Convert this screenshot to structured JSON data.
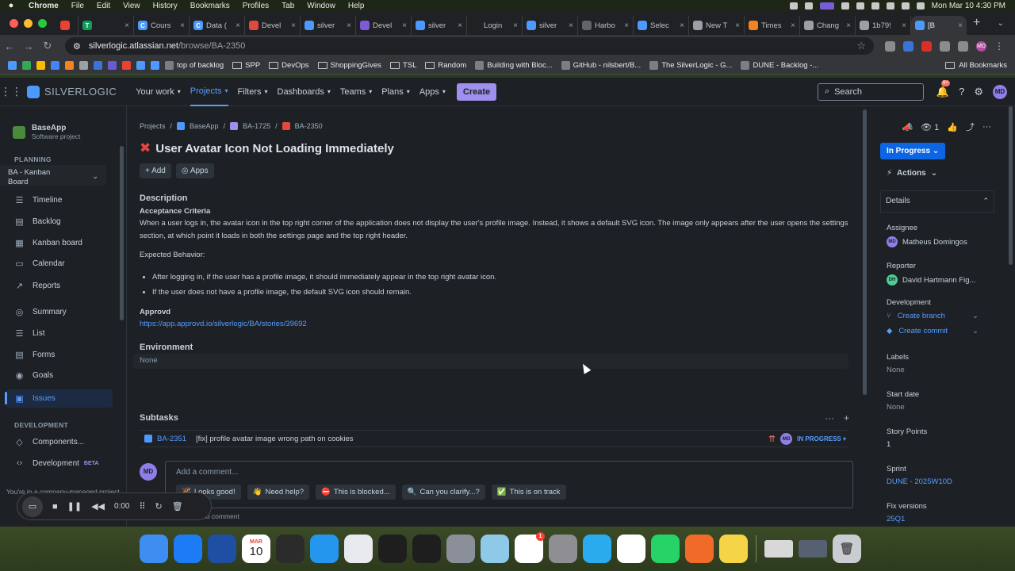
{
  "menubar": {
    "app": "Chrome",
    "items": [
      "File",
      "Edit",
      "View",
      "History",
      "Bookmarks",
      "Profiles",
      "Tab",
      "Window",
      "Help"
    ],
    "clock": "Mon Mar 10  4:30 PM"
  },
  "tabs": [
    {
      "label": "",
      "color": "#e94235"
    },
    {
      "label": "",
      "color": "#0f9d58",
      "glyph": "T"
    },
    {
      "label": "Cours",
      "color": "#4c9aff",
      "glyph": "C"
    },
    {
      "label": "Data (",
      "color": "#4c9aff",
      "glyph": "C"
    },
    {
      "label": "Devel",
      "color": "#e2483d"
    },
    {
      "label": "silver",
      "color": "#4c9aff"
    },
    {
      "label": "Devel",
      "color": "#7c5cd6"
    },
    {
      "label": "silver",
      "color": "#4c9aff"
    },
    {
      "label": "Login",
      "color": "#202124"
    },
    {
      "label": "silver",
      "color": "#4c9aff"
    },
    {
      "label": "Harbo",
      "color": "#60646b"
    },
    {
      "label": "Selec",
      "color": "#4c9aff"
    },
    {
      "label": "New T",
      "color": "#9aa0a6"
    },
    {
      "label": "Times",
      "color": "#f4821f"
    },
    {
      "label": "Chang",
      "color": "#9aa0a6"
    },
    {
      "label": "1b79!",
      "color": "#9aa0a6"
    },
    {
      "label": "[B",
      "color": "#4c9aff",
      "active": true
    }
  ],
  "address": {
    "host": "silverlogic.atlassian.net",
    "path": "/browse/BA-2350"
  },
  "bookmarks": [
    {
      "label": "top of backlog",
      "kind": "link"
    },
    {
      "label": "SPP",
      "kind": "folder"
    },
    {
      "label": "DevOps",
      "kind": "folder"
    },
    {
      "label": "ShoppingGives",
      "kind": "folder"
    },
    {
      "label": "TSL",
      "kind": "folder"
    },
    {
      "label": "Random",
      "kind": "folder"
    },
    {
      "label": "Building with Bloc...",
      "kind": "link"
    },
    {
      "label": "GitHub - nilsbert/B...",
      "kind": "link"
    },
    {
      "label": "The SilverLogic - G...",
      "kind": "link"
    },
    {
      "label": "DUNE - Backlog -...",
      "kind": "link"
    }
  ],
  "bookmarks_all": "All Bookmarks",
  "jira_nav": {
    "logo": "SILVERLOGIC",
    "items": [
      "Your work",
      "Projects",
      "Filters",
      "Dashboards",
      "Teams",
      "Plans",
      "Apps"
    ],
    "active": "Projects",
    "create": "Create",
    "search": "Search",
    "notif_count": "9+",
    "avatar": "MD"
  },
  "sidebar": {
    "project_name": "BaseApp",
    "project_type": "Software project",
    "planning_header": "PLANNING",
    "board_line1": "BA - Kanban",
    "board_line2": "Board",
    "items": [
      {
        "label": "Timeline",
        "icon": "timeline-icon"
      },
      {
        "label": "Backlog",
        "icon": "backlog-icon"
      },
      {
        "label": "Kanban board",
        "icon": "board-icon"
      },
      {
        "label": "Calendar",
        "icon": "calendar-icon"
      },
      {
        "label": "Reports",
        "icon": "reports-icon"
      },
      {
        "label": "Summary",
        "icon": "globe-icon"
      },
      {
        "label": "List",
        "icon": "list-icon"
      },
      {
        "label": "Forms",
        "icon": "forms-icon"
      },
      {
        "label": "Goals",
        "icon": "goals-icon"
      },
      {
        "label": "Issues",
        "icon": "issues-icon",
        "active": true
      }
    ],
    "development_header": "DEVELOPMENT",
    "dev_items": [
      {
        "label": "Components...",
        "icon": "components-icon"
      },
      {
        "label": "Development",
        "icon": "code-icon",
        "badge": "BETA"
      }
    ],
    "company_note": "You're in a company-managed project"
  },
  "issue": {
    "breadcrumb": [
      "Projects",
      "BaseApp",
      "BA-1725",
      "BA-2350"
    ],
    "title": "User Avatar Icon Not Loading Immediately",
    "add": "Add",
    "apps": "Apps",
    "description_header": "Description",
    "acceptance_header": "Acceptance Criteria",
    "acceptance_text": "When a user logs in, the avatar icon in the top right corner of the application does not display the user's profile image. Instead, it shows a default SVG icon. The image only appears after the user opens the settings section, at which point it loads in both the settings page and the top right header.",
    "expected_header": "Expected Behavior:",
    "expected_items": [
      "After logging in, if the user has a profile image, it should immediately appear in the top right avatar icon.",
      "If the user does not have a profile image, the default SVG icon should remain."
    ],
    "approvd_header": "Approvd",
    "approvd_link": "https://app.approvd.io/silverlogic/BA/stories/39692",
    "environment_header": "Environment",
    "environment_value": "None",
    "subtasks_header": "Subtasks",
    "subtask": {
      "key": "BA-2351",
      "title": "[fix] profile avatar image wrong path on cookies",
      "assignee": "MD",
      "status": "IN PROGRESS"
    },
    "comment_avatar": "MD",
    "comment_placeholder": "Add a comment...",
    "quick_replies": [
      {
        "emoji": "🎉",
        "label": "Looks good!"
      },
      {
        "emoji": "👋",
        "label": "Need help?"
      },
      {
        "emoji": "⛔",
        "label": "This is blocked..."
      },
      {
        "emoji": "🔍",
        "label": "Can you clarify...?"
      },
      {
        "emoji": "✅",
        "label": "This is on track"
      }
    ],
    "tip_key": "M",
    "tip_text": "to comment"
  },
  "details": {
    "watchers": "1",
    "status": "In Progress",
    "actions": "Actions",
    "header": "Details",
    "assignee_label": "Assignee",
    "assignee": "Matheus Domingos",
    "assignee_initials": "MD",
    "reporter_label": "Reporter",
    "reporter": "David Hartmann Fig...",
    "reporter_initials": "DH",
    "development_label": "Development",
    "create_branch": "Create branch",
    "create_commit": "Create commit",
    "labels_label": "Labels",
    "labels_value": "None",
    "start_label": "Start date",
    "start_value": "None",
    "story_points_label": "Story Points",
    "story_points_value": "1",
    "sprint_label": "Sprint",
    "sprint_value": "DUNE - 2025W10D",
    "fix_label": "Fix versions",
    "fix_value": "25Q1"
  },
  "recorder": {
    "time": "0:00"
  },
  "dock": {
    "calendar_month": "MAR",
    "calendar_day": "10",
    "slack_badge": "1",
    "apps": [
      {
        "name": "finder-icon",
        "color": "#3d8ef0"
      },
      {
        "name": "app-store-icon",
        "color": "#1c7cf5"
      },
      {
        "name": "shield-app-icon",
        "color": "#1f4fa3"
      },
      {
        "name": "calendar-icon",
        "color": "#ffffff"
      },
      {
        "name": "cube-app-icon",
        "color": "#2b2b2b"
      },
      {
        "name": "docker-icon",
        "color": "#2496ed"
      },
      {
        "name": "chrome-icon",
        "color": "#e8eaed"
      },
      {
        "name": "terminal-icon",
        "color": "#1e1e1e"
      },
      {
        "name": "figma-icon",
        "color": "#1e1e1e"
      },
      {
        "name": "launchpad-icon",
        "color": "#8a8f99"
      },
      {
        "name": "tableplus-icon",
        "color": "#8fc9e8"
      },
      {
        "name": "slack-icon",
        "color": "#ffffff"
      },
      {
        "name": "settings-icon",
        "color": "#8e8e93"
      },
      {
        "name": "telegram-icon",
        "color": "#2aabee"
      },
      {
        "name": "chatgpt-icon",
        "color": "#ffffff"
      },
      {
        "name": "whatsapp-icon",
        "color": "#25d366"
      },
      {
        "name": "pen-app-icon",
        "color": "#f06a2a"
      },
      {
        "name": "notes-icon",
        "color": "#f5d547"
      }
    ]
  }
}
